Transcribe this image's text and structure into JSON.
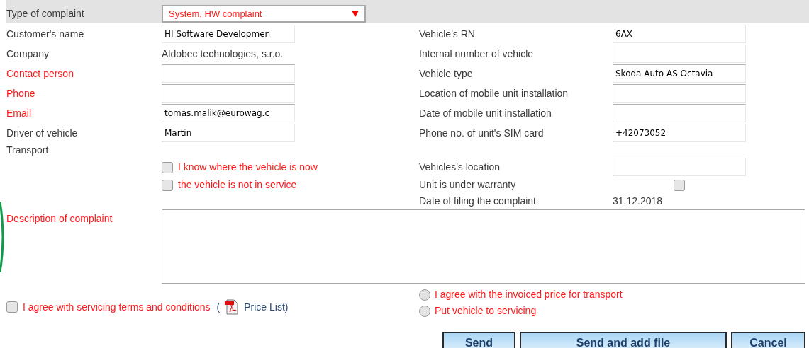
{
  "complaint_type": {
    "label": "Type of complaint",
    "value": "System, HW complaint",
    "required": false
  },
  "customer_fields": [
    {
      "label": "Customer's name",
      "kind": "input",
      "value": "HI Software Developmen",
      "required": false
    },
    {
      "label": "Company",
      "kind": "text",
      "value": "Aldobec technologies, s.r.o.",
      "required": false
    },
    {
      "label": "Contact person",
      "kind": "input",
      "required": true
    },
    {
      "label": "Phone",
      "kind": "input",
      "required": true
    },
    {
      "label": "Email",
      "kind": "input",
      "value": "tomas.malik@eurowag.c",
      "required": true
    },
    {
      "label": "Driver of vehicle",
      "kind": "input",
      "value": "Martin",
      "required": false
    }
  ],
  "vehicle_fields": [
    {
      "label": "Vehicle's RN",
      "kind": "input",
      "value": "6AX",
      "required": false
    },
    {
      "label": "Internal number of vehicle",
      "kind": "input",
      "required": false
    },
    {
      "label": "Vehicle type",
      "kind": "input",
      "value": "Skoda Auto AS Octavia",
      "required": false
    },
    {
      "label": "Location of mobile unit installation",
      "kind": "input",
      "required": false
    },
    {
      "label": "Date of mobile unit installation",
      "kind": "input",
      "required": false
    },
    {
      "label": "Phone no. of unit's SIM card",
      "kind": "input",
      "value": "+42073052",
      "required": false
    }
  ],
  "transport": {
    "label": "Transport",
    "options": [
      {
        "label": "I know where the vehicle is now",
        "checked": false,
        "required": true
      },
      {
        "label": "the vehicle is not in service",
        "checked": false,
        "required": true
      }
    ]
  },
  "location_fields": [
    {
      "label": "Vehicles's location",
      "kind": "input",
      "required": false
    },
    {
      "label": "Unit is under warranty",
      "kind": "checkbox",
      "checked": false,
      "required": false
    },
    {
      "label": "Date of filing the complaint",
      "kind": "text",
      "value": "31.12.2018",
      "required": false
    }
  ],
  "description": {
    "label": "Description of complaint",
    "required": true
  },
  "terms": {
    "label": "I agree with servicing terms and conditions",
    "checked": false,
    "open_paren": "(",
    "link": "Price List)"
  },
  "choices": [
    {
      "label": "I agree with the invoiced price for transport",
      "selected": false
    },
    {
      "label": "Put vehicle to servicing",
      "selected": false
    }
  ],
  "buttons": [
    {
      "label": "Send"
    },
    {
      "label": "Send and add file"
    },
    {
      "label": "Cancel"
    }
  ]
}
